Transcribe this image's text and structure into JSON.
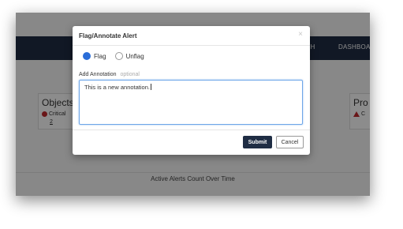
{
  "background": {
    "nav": [
      "ARCH",
      "DASHBOAR"
    ],
    "cards": [
      {
        "title": "Objects",
        "status": "Critical",
        "count": "2"
      },
      {
        "title": "Pro",
        "status": "C"
      }
    ],
    "chart_title": "Active Alerts Count Over Time"
  },
  "modal": {
    "title": "Flag/Annotate Alert",
    "close_icon": "×",
    "options": [
      "Flag",
      "Unflag"
    ],
    "selected": "Flag",
    "annotation_label": "Add Annotation",
    "annotation_hint": "optional",
    "annotation_value": "This is a new annotation.",
    "submit_label": "Submit",
    "cancel_label": "Cancel"
  },
  "colors": {
    "navbar": "#1f2d44",
    "accent": "#2a6dd8",
    "critical": "#c0282d"
  }
}
